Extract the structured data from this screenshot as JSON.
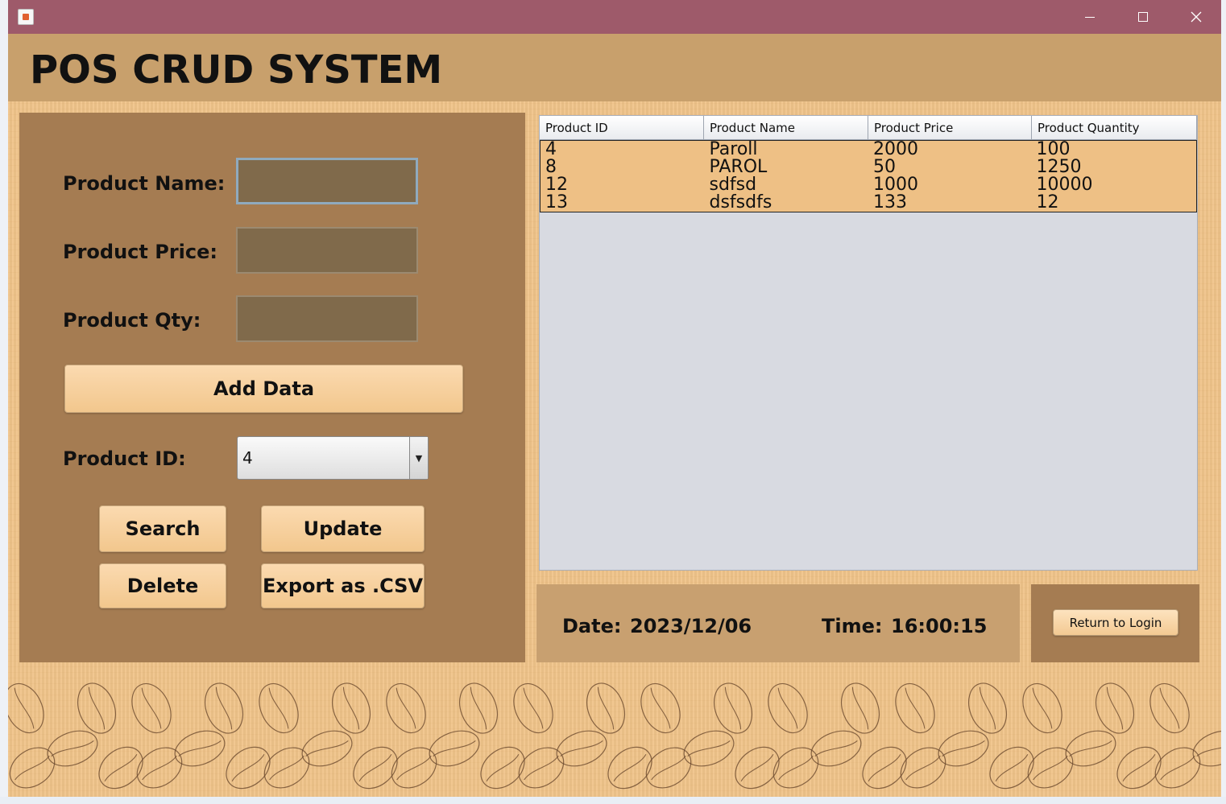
{
  "window": {
    "icon": "java-coffee-cup-icon",
    "controls": [
      "minimize-icon",
      "maximize-icon",
      "close-icon"
    ]
  },
  "header": {
    "title": "POS CRUD SYSTEM"
  },
  "form": {
    "product_name_label": "Product Name:",
    "product_price_label": "Product Price:",
    "product_qty_label": "Product Qty:",
    "product_name_value": "",
    "product_price_value": "",
    "product_qty_value": "",
    "add_button": "Add Data",
    "product_id_label": "Product ID:",
    "product_id_selected": "4",
    "search_button": "Search",
    "update_button": "Update",
    "delete_button": "Delete",
    "export_button": "Export as .CSV"
  },
  "table": {
    "columns": [
      "Product ID",
      "Product Name",
      "Product Price",
      "Product Quantity"
    ],
    "rows": [
      [
        "4",
        "Paroll",
        "2000",
        "100"
      ],
      [
        "8",
        "PAROL",
        "50",
        "1250"
      ],
      [
        "12",
        "sdfsd",
        "1000",
        "10000"
      ],
      [
        "13",
        "dsfsdfs",
        "133",
        "12"
      ]
    ]
  },
  "status": {
    "date_label": "Date:",
    "date_value": "2023/12/06",
    "time_label": "Time:",
    "time_value": "16:00:15"
  },
  "return_button": "Return to Login",
  "colors": {
    "titlebar": "#9e5a6a",
    "header": "#c8a06c",
    "panel": "#a57c52",
    "table_rows": "#eec085"
  }
}
